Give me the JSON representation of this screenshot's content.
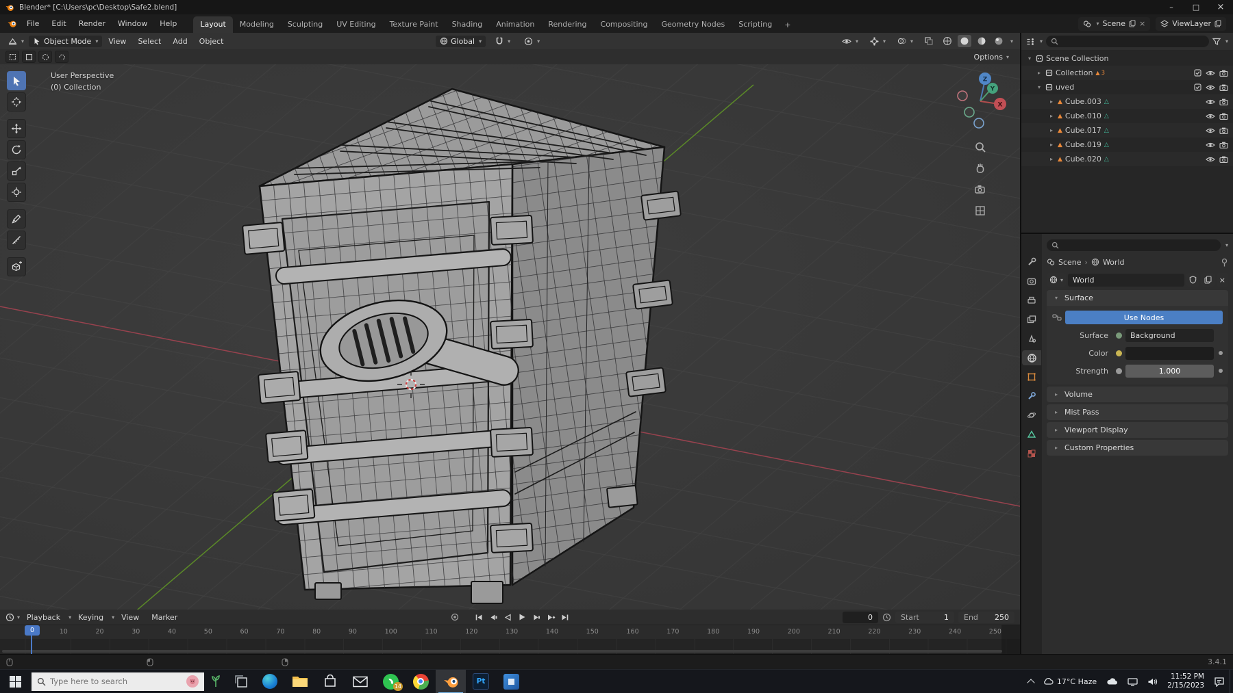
{
  "window": {
    "title": "Blender* [C:\\Users\\pc\\Desktop\\Safe2.blend]"
  },
  "icons": {
    "dropdown": "▾",
    "arrow_right": "▸",
    "arrow_down": "▾",
    "close": "×",
    "minimize": "–",
    "maximize": "□",
    "separator": "›",
    "mesh": "▲",
    "mesh_data": "△"
  },
  "topbar": {
    "menus": [
      "File",
      "Edit",
      "Render",
      "Window",
      "Help"
    ],
    "workspaces": [
      "Layout",
      "Modeling",
      "Sculpting",
      "UV Editing",
      "Texture Paint",
      "Shading",
      "Animation",
      "Rendering",
      "Compositing",
      "Geometry Nodes",
      "Scripting"
    ],
    "add_tab": "+",
    "scene": "Scene",
    "view_layer": "ViewLayer"
  },
  "viewport": {
    "mode": "Object Mode",
    "menus": [
      "View",
      "Select",
      "Add",
      "Object"
    ],
    "orientation": "Global",
    "options": "Options",
    "label_perspective": "User Perspective",
    "label_collection": "(0) Collection",
    "axis_x": "X",
    "axis_y": "Y",
    "axis_z": "Z"
  },
  "outliner": {
    "scene_collection": "Scene Collection",
    "collection": "Collection",
    "collection_badge": "3",
    "sub_collection": "uved",
    "objects": [
      "Cube.003",
      "Cube.010",
      "Cube.017",
      "Cube.019",
      "Cube.020"
    ]
  },
  "properties": {
    "breadcrumb_scene": "Scene",
    "breadcrumb_world": "World",
    "datablock_name": "World",
    "surface": {
      "title": "Surface",
      "use_nodes": "Use Nodes",
      "surface_label": "Surface",
      "surface_value": "Background",
      "color_label": "Color",
      "strength_label": "Strength",
      "strength_value": "1.000"
    },
    "panels": [
      "Volume",
      "Mist Pass",
      "Viewport Display",
      "Custom Properties"
    ]
  },
  "timeline": {
    "menus": [
      "Playback",
      "Keying",
      "View",
      "Marker"
    ],
    "frame": "0",
    "start_label": "Start",
    "start_value": "1",
    "end_label": "End",
    "end_value": "250",
    "ticks": [
      "0",
      "10",
      "20",
      "30",
      "40",
      "50",
      "60",
      "70",
      "80",
      "90",
      "100",
      "110",
      "120",
      "130",
      "140",
      "150",
      "160",
      "170",
      "180",
      "190",
      "200",
      "210",
      "220",
      "230",
      "240",
      "250"
    ]
  },
  "statusbar": {
    "version": "3.4.1"
  },
  "taskbar": {
    "search_placeholder": "Type here to search",
    "whatsapp_badge": "14",
    "photoshop_label": "Pt",
    "weather": "17°C Haze",
    "time": "11:52 PM",
    "date": "2/15/2023"
  }
}
